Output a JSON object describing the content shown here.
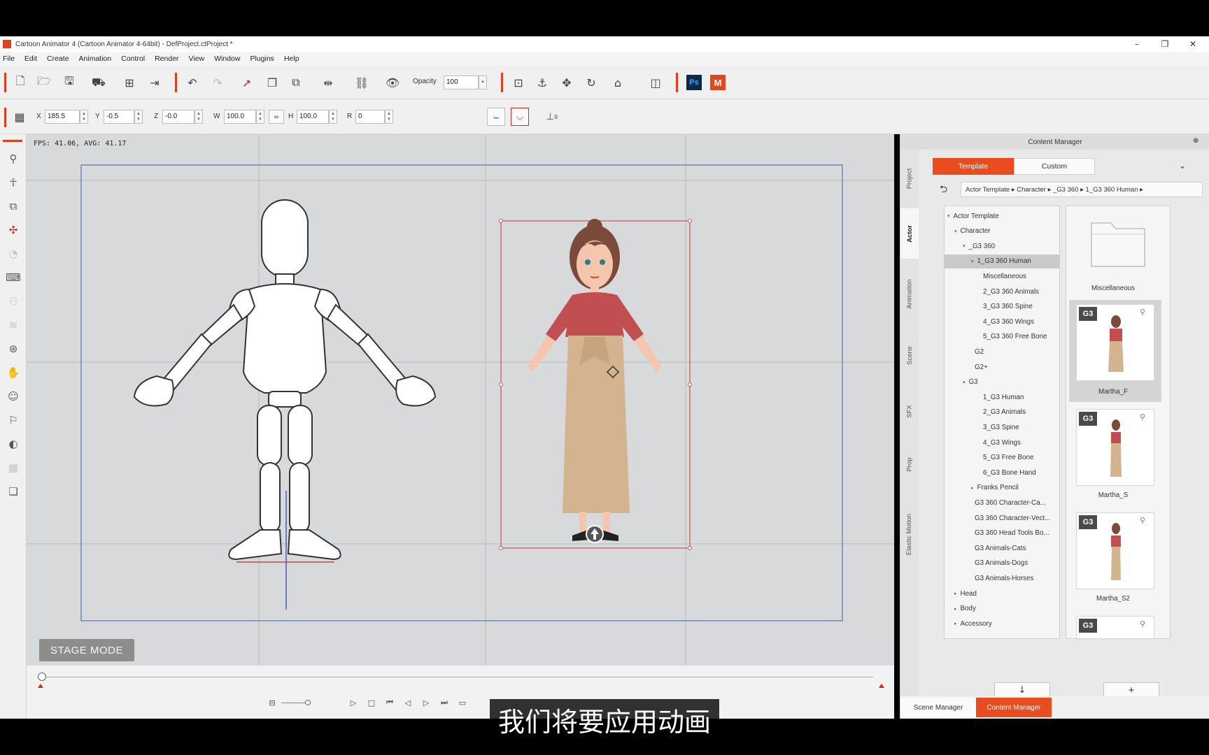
{
  "window": {
    "title": "Cartoon Animator 4  (Cartoon Animator 4-64bit) - DefProject.ctProject *",
    "minimize": "–",
    "restore": "❐",
    "close": "✕"
  },
  "menu": [
    "File",
    "Edit",
    "Create",
    "Animation",
    "Control",
    "Render",
    "View",
    "Window",
    "Plugins",
    "Help"
  ],
  "toolbar": {
    "opacity_label": "Opacity",
    "opacity_value": "100",
    "ps_label": "Ps",
    "m_label": "M"
  },
  "transform": {
    "x_label": "X",
    "x": "185.5",
    "y_label": "Y",
    "y": "-0.5",
    "z_label": "Z",
    "z": "-0.0",
    "w_label": "W",
    "w": "100.0",
    "h_label": "H",
    "h": "100.0",
    "r_label": "R",
    "r": "0",
    "link_label": "∞",
    "offset_label": "0"
  },
  "stage": {
    "fps": "FPS: 41.06, AVG: 41.17",
    "mode": "STAGE MODE"
  },
  "content_manager": {
    "title": "Content Manager",
    "tabs": {
      "template": "Template",
      "custom": "Custom"
    },
    "vtabs": [
      "Project",
      "Actor",
      "Animation",
      "Scene",
      "SFX",
      "Prop",
      "Elastic Motion"
    ],
    "breadcrumb": "Actor Template ▸  Character ▸  _G3 360 ▸  1_G3 360 Human ▸",
    "tree": [
      {
        "label": "Actor Template",
        "tri": "▾"
      },
      {
        "label": "Character",
        "tri": "▾"
      },
      {
        "label": "_G3 360",
        "tri": "▾"
      },
      {
        "label": "1_G3 360 Human",
        "tri": "▾"
      },
      {
        "label": "Miscellaneous",
        "tri": ""
      },
      {
        "label": "2_G3 360 Animals",
        "tri": ""
      },
      {
        "label": "3_G3 360 Spine",
        "tri": ""
      },
      {
        "label": "4_G3 360 Wings",
        "tri": ""
      },
      {
        "label": "5_G3 360 Free Bone",
        "tri": ""
      },
      {
        "label": "G2",
        "tri": ""
      },
      {
        "label": "G2+",
        "tri": ""
      },
      {
        "label": "G3",
        "tri": "▾"
      },
      {
        "label": "1_G3 Human",
        "tri": ""
      },
      {
        "label": "2_G3 Animals",
        "tri": ""
      },
      {
        "label": "3_G3 Spine",
        "tri": ""
      },
      {
        "label": "4_G3 Wings",
        "tri": ""
      },
      {
        "label": "5_G3 Free Bone",
        "tri": ""
      },
      {
        "label": "6_G3 Bone Hand",
        "tri": ""
      },
      {
        "label": "Franks Pencil",
        "tri": "▸"
      },
      {
        "label": "G3 360 Character-Ca...",
        "tri": ""
      },
      {
        "label": "G3 360 Character-Vect...",
        "tri": ""
      },
      {
        "label": "G3 360 Head Tools Bo...",
        "tri": ""
      },
      {
        "label": "G3 Animals-Cats",
        "tri": ""
      },
      {
        "label": "G3 Animals-Dogs",
        "tri": ""
      },
      {
        "label": "G3 Animals-Horses",
        "tri": ""
      },
      {
        "label": "Head",
        "tri": "▸"
      },
      {
        "label": "Body",
        "tri": "▸"
      },
      {
        "label": "Accessory",
        "tri": "▸"
      }
    ],
    "thumbs": [
      {
        "label": "Miscellaneous",
        "badge": ""
      },
      {
        "label": "Martha_F",
        "badge": "G3"
      },
      {
        "label": "Martha_S",
        "badge": "G3"
      },
      {
        "label": "Martha_S2",
        "badge": "G3"
      },
      {
        "label": "",
        "badge": "G3"
      }
    ],
    "download": "↓",
    "add": "+",
    "bottom_tabs": {
      "scene": "Scene Manager",
      "cm": "Content Manager"
    }
  },
  "subtitle": "我们将要应用动画",
  "colors": {
    "accent": "#e94d1f",
    "stage_bg": "#d8d9da"
  }
}
